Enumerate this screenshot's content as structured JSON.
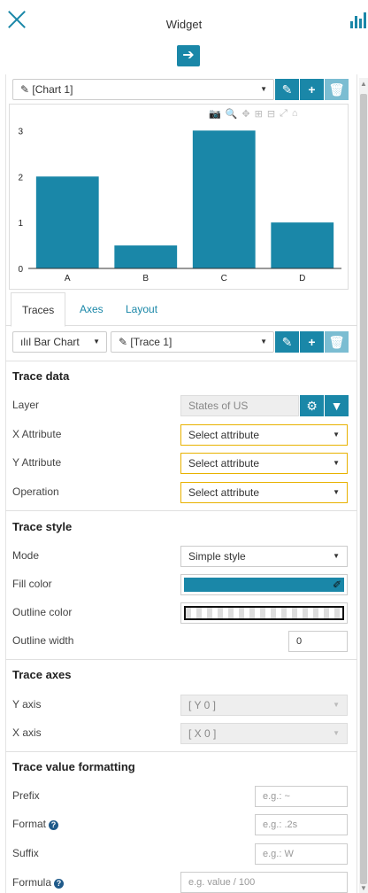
{
  "header": {
    "title": "Widget",
    "arrow": "➔"
  },
  "chart_selector": {
    "value": "[Chart 1]"
  },
  "toolbar_icons": [
    "pencil-icon",
    "plus-icon",
    "trash-icon"
  ],
  "plot_tools": [
    "camera-icon",
    "zoom-icon",
    "pan-icon",
    "zoom-in-icon",
    "zoom-out-icon",
    "autoscale-icon",
    "home-icon"
  ],
  "chart_data": {
    "type": "bar",
    "categories": [
      "A",
      "B",
      "C",
      "D"
    ],
    "values": [
      2,
      0.5,
      3,
      1
    ],
    "y_ticks": [
      "0",
      "1",
      "2",
      "3"
    ],
    "ylim": [
      0,
      3.2
    ],
    "color": "#1a87a8",
    "grid": false
  },
  "tabs": [
    {
      "label": "Traces",
      "active": true
    },
    {
      "label": "Axes",
      "active": false
    },
    {
      "label": "Layout",
      "active": false
    }
  ],
  "trace_row": {
    "type_label": "Bar Chart",
    "trace_value": "[Trace 1]"
  },
  "trace_data": {
    "title": "Trace data",
    "layer_label": "Layer",
    "layer_value": "States of US",
    "x_label": "X Attribute",
    "x_value": "Select attribute",
    "y_label": "Y Attribute",
    "y_value": "Select attribute",
    "op_label": "Operation",
    "op_value": "Select attribute"
  },
  "trace_style": {
    "title": "Trace style",
    "mode_label": "Mode",
    "mode_value": "Simple style",
    "fill_label": "Fill color",
    "fill_color": "#1a87a8",
    "outline_label": "Outline color",
    "outline_width_label": "Outline width",
    "outline_width_value": "0"
  },
  "trace_axes": {
    "title": "Trace axes",
    "y_label": "Y axis",
    "y_value": "[ Y 0 ]",
    "x_label": "X axis",
    "x_value": "[ X 0 ]"
  },
  "formatting": {
    "title": "Trace value formatting",
    "prefix_label": "Prefix",
    "prefix_placeholder": "e.g.: ~",
    "format_label": "Format",
    "format_placeholder": "e.g.: .2s",
    "suffix_label": "Suffix",
    "suffix_placeholder": "e.g.: W",
    "formula_label": "Formula",
    "formula_placeholder": "e.g. value / 100"
  }
}
